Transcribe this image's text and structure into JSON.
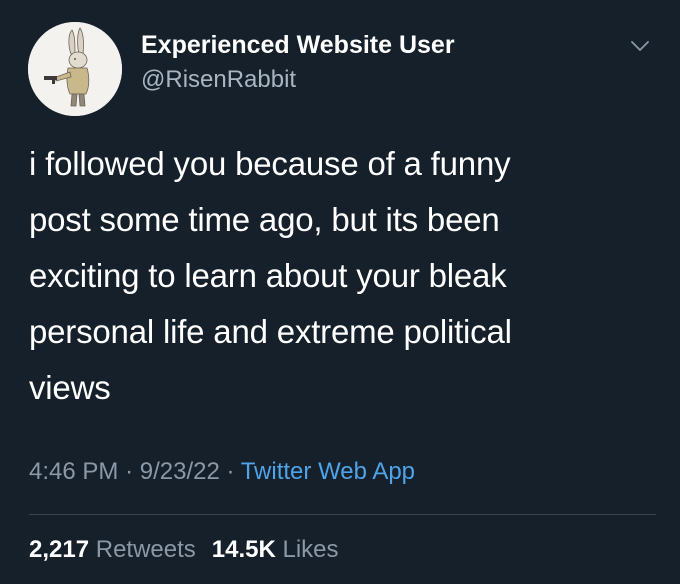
{
  "tweet": {
    "display_name": "Experienced Website User",
    "handle": "@RisenRabbit",
    "text": "i followed you because of a funny\npost some time ago, but its been\nexciting to learn about your bleak\npersonal life and extreme political\nviews",
    "time": "4:46 PM",
    "separator": "·",
    "date": "9/23/22",
    "source": "Twitter Web App",
    "retweets_count": "2,217",
    "retweets_label": "Retweets",
    "likes_count": "14.5K",
    "likes_label": "Likes"
  },
  "icons": {
    "avatar": "rabbit-avatar",
    "more": "chevron-down-icon"
  },
  "colors": {
    "background": "#15202b",
    "text_primary": "#ffffff",
    "text_secondary": "#8b98a5",
    "link": "#4fa3e8",
    "divider": "#38444d"
  }
}
